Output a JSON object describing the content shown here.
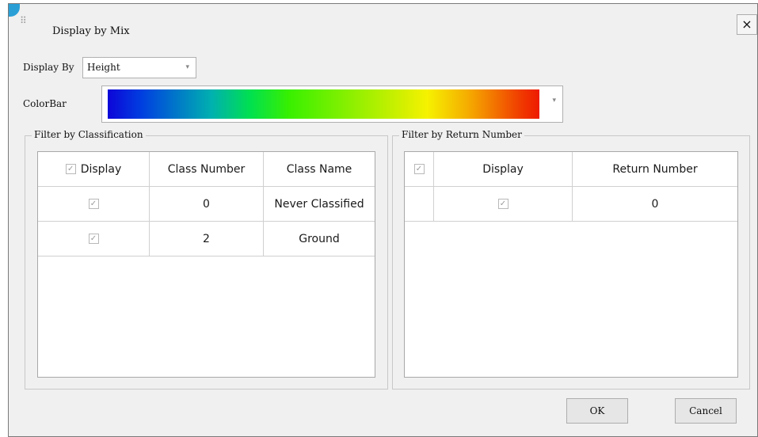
{
  "dialog": {
    "title": "Display by Mix",
    "close_symbol": "×"
  },
  "display_by": {
    "label": "Display By",
    "value": "Height"
  },
  "colorbar": {
    "label": "ColorBar",
    "gradient_colors": [
      "#0d05d8",
      "#00b0b0",
      "#38f000",
      "#f6f200",
      "#f5a800",
      "#ee1a00"
    ]
  },
  "classification": {
    "group_title": "Filter by Classification",
    "columns": [
      "Display",
      "Class Number",
      "Class Name"
    ],
    "rows": [
      {
        "display": "✓",
        "class_number": "0",
        "class_name": "Never Classified"
      },
      {
        "display": "✓",
        "class_number": "2",
        "class_name": "Ground"
      }
    ]
  },
  "return_number": {
    "group_title": "Filter by Return Number",
    "columns": [
      "Display",
      "Return Number"
    ],
    "rows": [
      {
        "display": "✓",
        "return_number": "0"
      }
    ]
  },
  "buttons": {
    "ok": "OK",
    "cancel": "Cancel"
  },
  "icons": {
    "check": "✓",
    "dropdown": "▾"
  }
}
